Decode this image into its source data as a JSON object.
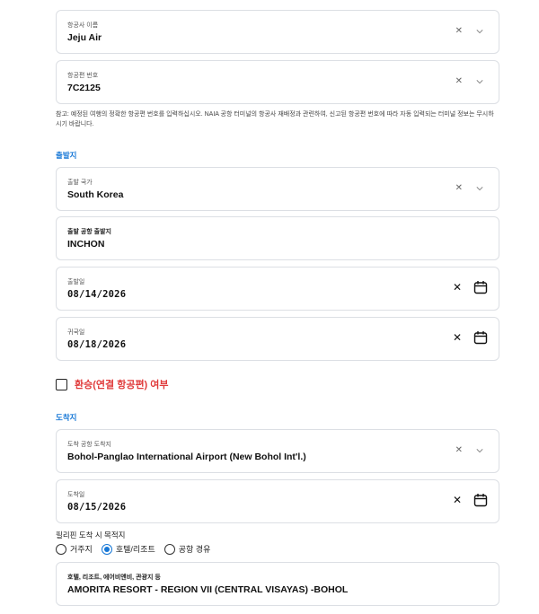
{
  "airline": {
    "label": "항공사 이름",
    "value": "Jeju Air"
  },
  "flight_no": {
    "label": "항공편 번호",
    "value": "7C2125"
  },
  "note": "참고: 예정된 여행의 정확한 항공편 번호를 입력하십시오. NAIA 공항 터미널의 항공사 재배정과 관련하여, 신고된 항공편 번호에 따라 자동 입력되는 터미널 정보는 무시하시기 바랍니다.",
  "departure": {
    "section_title": "출발지",
    "country": {
      "label": "출발 국가",
      "value": "South Korea"
    },
    "airport": {
      "label": "출발 공항 출발지",
      "value": "INCHON"
    },
    "depart_date": {
      "label": "출발일",
      "value": "08/14/2026"
    },
    "return_date": {
      "label": "귀국일",
      "value": "08/18/2026"
    }
  },
  "transfer": {
    "label": "환승(연결 항공편) 여부",
    "checked": false
  },
  "arrival": {
    "section_title": "도착지",
    "airport": {
      "label": "도착 공항 도착지",
      "value": "Bohol-Panglao International Airport (New Bohol Int'l.)"
    },
    "arrive_date": {
      "label": "도착일",
      "value": "08/15/2026"
    }
  },
  "purpose": {
    "title": "필리핀 도착 시 목적지",
    "options": [
      "거주지",
      "호텔/리조트",
      "공항 경유"
    ],
    "selected": "호텔/리조트"
  },
  "accommodation": {
    "label": "호텔, 리조트, 에어비앤비, 관광지 등",
    "value": "AMORITA RESORT - REGION VII (CENTRAL VISAYAS) -BOHOL"
  },
  "colors": {
    "accent": "#1677d6",
    "warning": "#e03a3a",
    "border": "#dcdfe4"
  }
}
